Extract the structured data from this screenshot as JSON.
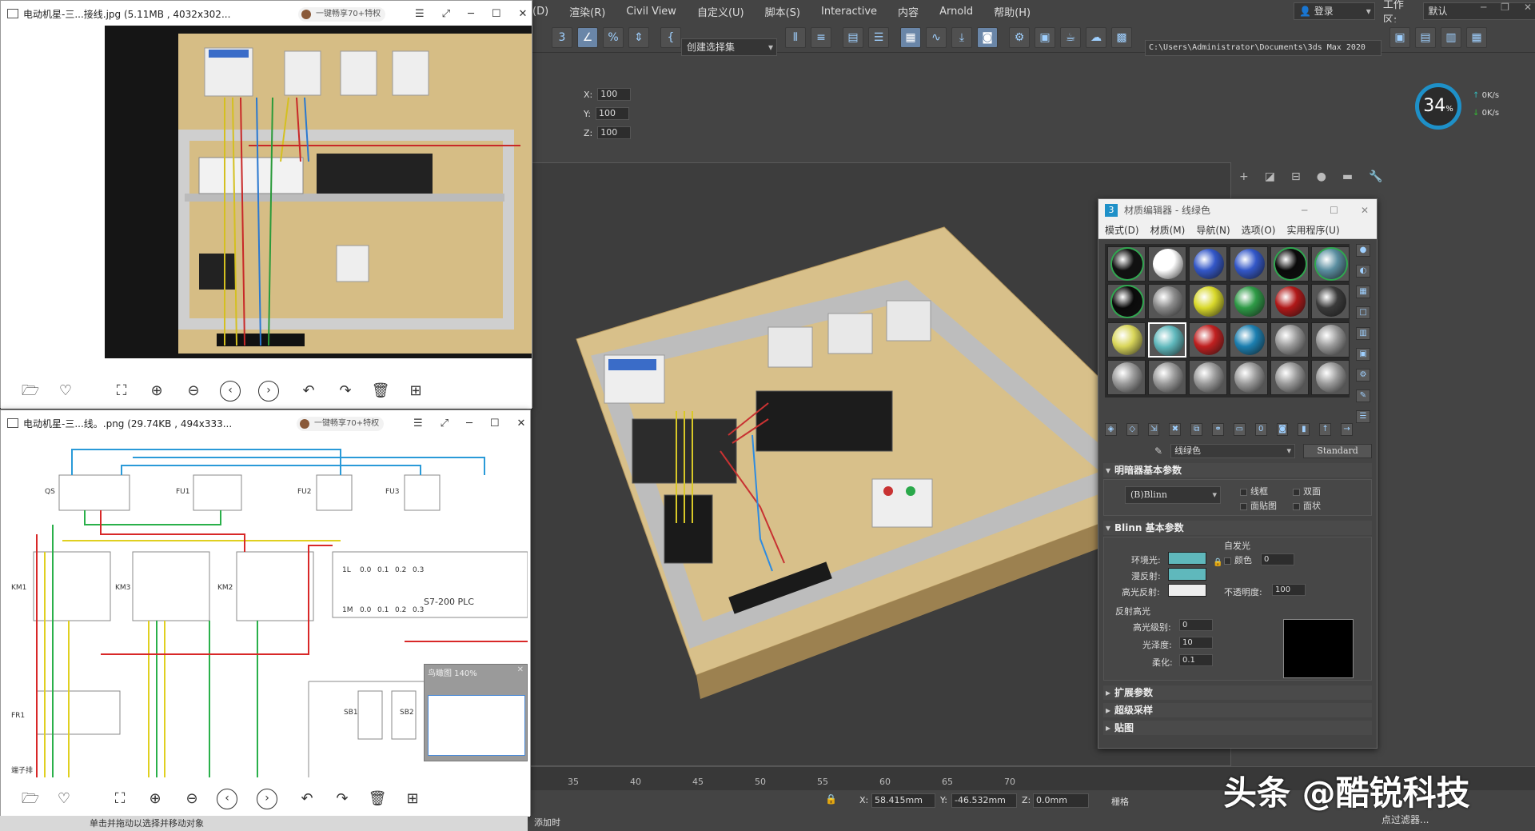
{
  "max": {
    "menu": [
      "(D)",
      "渲染(R)",
      "Civil View",
      "自定义(U)",
      "脚本(S)",
      "Interactive",
      "内容",
      "Arnold",
      "帮助(H)"
    ],
    "login": "登录",
    "workspace_label": "工作区:",
    "workspace_value": "默认",
    "selection_set": "创建选择集",
    "project_path": "C:\\Users\\Administrator\\Documents\\3ds Max 2020",
    "xyz": {
      "x_label": "X:",
      "y_label": "Y:",
      "z_label": "Z:",
      "x": "100",
      "y": "100",
      "z": "100"
    },
    "gauge": {
      "percent": "34",
      "unit": "%",
      "up": "0K/s",
      "down": "0K/s"
    },
    "timeline_ticks": [
      "35",
      "40",
      "45",
      "50",
      "55",
      "60",
      "65",
      "70"
    ],
    "status": {
      "x_label": "X:",
      "x": "58.415mm",
      "y_label": "Y:",
      "y": "-46.532mm",
      "z_label": "Z:",
      "z": "0.0mm",
      "grid_label": "栅格",
      "add_time": "添加时",
      "filter": "点过滤器...",
      "prompt": "单击并拖动以选择并移动对象"
    },
    "watermark": "头条 @酷锐科技"
  },
  "material_editor": {
    "title": "材质编辑器 - 线绿色",
    "menu": [
      "模式(D)",
      "材质(M)",
      "导航(N)",
      "选项(O)",
      "实用程序(U)"
    ],
    "slots": [
      {
        "color": "#111111",
        "ring": "#2fa84f"
      },
      {
        "color": "#ffffff",
        "ring": ""
      },
      {
        "color": "#3357c8",
        "ring": ""
      },
      {
        "color": "#3357c8",
        "ring": ""
      },
      {
        "color": "#0a0a0a",
        "ring": "#2fa84f"
      },
      {
        "color": "#5a8ea0",
        "ring": "#2fa84f"
      },
      {
        "color": "#0a0a0a",
        "ring": "#2fa84f"
      },
      {
        "color": "#8a8a8a",
        "ring": ""
      },
      {
        "color": "#d8d82a",
        "ring": ""
      },
      {
        "color": "#2e9a46",
        "ring": ""
      },
      {
        "color": "#b01818",
        "ring": ""
      },
      {
        "color": "#3a3a3a",
        "ring": ""
      },
      {
        "color": "#d9d65a",
        "ring": ""
      },
      {
        "color": "#5fb8bc",
        "ring": ""
      },
      {
        "color": "#c02020",
        "ring": ""
      },
      {
        "color": "#1c7fb0",
        "ring": ""
      },
      {
        "color": "#9a9a9a",
        "ring": ""
      },
      {
        "color": "#9a9a9a",
        "ring": ""
      },
      {
        "color": "#9a9a9a",
        "ring": ""
      },
      {
        "color": "#9a9a9a",
        "ring": ""
      },
      {
        "color": "#9a9a9a",
        "ring": ""
      },
      {
        "color": "#9a9a9a",
        "ring": ""
      },
      {
        "color": "#9a9a9a",
        "ring": ""
      },
      {
        "color": "#9a9a9a",
        "ring": ""
      }
    ],
    "active_slot": 13,
    "material_name": "线绿色",
    "material_type": "Standard",
    "shader_rollout": "明暗器基本参数",
    "shader": "(B)Blinn",
    "shader_opts": [
      "线框",
      "双面",
      "面贴图",
      "面状"
    ],
    "blinn_rollout": "Blinn 基本参数",
    "self_illum": "自发光",
    "color_label": "颜色",
    "color_value": "0",
    "ambient": "环境光:",
    "diffuse": "漫反射:",
    "specular": "高光反射:",
    "opacity_label": "不透明度:",
    "opacity": "100",
    "swatch_color": "#5fb8bc",
    "spec_color": "#eeeeee",
    "spec_highlights": "反射高光",
    "spec_level_label": "高光级别:",
    "spec_level": "0",
    "gloss_label": "光泽度:",
    "gloss": "10",
    "soften_label": "柔化:",
    "soften": "0.1",
    "rollouts_closed": [
      "扩展参数",
      "超级采样",
      "贴图"
    ]
  },
  "viewer1": {
    "title": "电动机星-三...接线.jpg (5.11MB , 4032x302...",
    "promo": "一键畅享70+特权"
  },
  "viewer2": {
    "title": "电动机星-三...线。.png (29.74KB , 494x333...",
    "promo": "一键畅享70+特权",
    "nav_title": "鸟瞰图 140%",
    "labels": [
      "QS",
      "FU1",
      "FU2",
      "FU3",
      "KM1",
      "KM3",
      "KM2",
      "FR1",
      "SB1",
      "SB2",
      "S7-200 PLC",
      "1L",
      "0.0",
      "0.1",
      "0.2",
      "0.3",
      "1M",
      "0.0",
      "0.1",
      "0.2",
      "0.3",
      "端子排"
    ]
  }
}
